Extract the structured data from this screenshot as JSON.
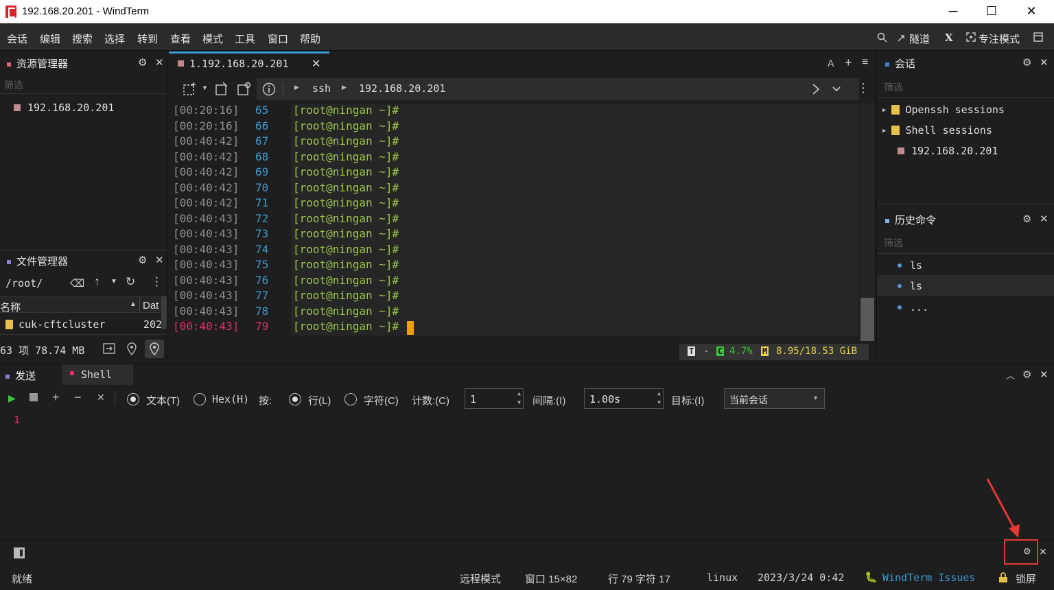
{
  "window": {
    "title": "192.168.20.201 - WindTerm",
    "minimize_glyph": "─",
    "maximize_glyph": "☐",
    "close_glyph": "✕"
  },
  "menubar": {
    "items": [
      "会话",
      "编辑",
      "搜索",
      "选择",
      "转到",
      "查看",
      "模式",
      "工具",
      "窗口",
      "帮助"
    ],
    "tunnel_label": "隧道",
    "x_label": "X",
    "focus_mode_label": "专注模式"
  },
  "explorer": {
    "title": "资源管理器",
    "filter_placeholder": "筛选",
    "host": "192.168.20.201"
  },
  "file_manager": {
    "title": "文件管理器",
    "path": "/root/",
    "col_name": "名称",
    "col_date": "Dat",
    "row_name": "cuk-cftcluster",
    "row_date": "202",
    "summary": "63 项 78.74 MB"
  },
  "terminal_tab": {
    "label": "1.192.168.20.201",
    "font_glyph": "A",
    "add_glyph": "+",
    "menu_glyph": "≡"
  },
  "breadcrumb": {
    "proto": "ssh",
    "host": "192.168.20.201"
  },
  "terminal": {
    "lines": [
      {
        "ts": "[00:20:16]",
        "n": "65",
        "prompt": "[root@ningan ~]#"
      },
      {
        "ts": "[00:20:16]",
        "n": "66",
        "prompt": "[root@ningan ~]#"
      },
      {
        "ts": "[00:40:42]",
        "n": "67",
        "prompt": "[root@ningan ~]#"
      },
      {
        "ts": "[00:40:42]",
        "n": "68",
        "prompt": "[root@ningan ~]#"
      },
      {
        "ts": "[00:40:42]",
        "n": "69",
        "prompt": "[root@ningan ~]#"
      },
      {
        "ts": "[00:40:42]",
        "n": "70",
        "prompt": "[root@ningan ~]#"
      },
      {
        "ts": "[00:40:42]",
        "n": "71",
        "prompt": "[root@ningan ~]#"
      },
      {
        "ts": "[00:40:43]",
        "n": "72",
        "prompt": "[root@ningan ~]#"
      },
      {
        "ts": "[00:40:43]",
        "n": "73",
        "prompt": "[root@ningan ~]#"
      },
      {
        "ts": "[00:40:43]",
        "n": "74",
        "prompt": "[root@ningan ~]#"
      },
      {
        "ts": "[00:40:43]",
        "n": "75",
        "prompt": "[root@ningan ~]#"
      },
      {
        "ts": "[00:40:43]",
        "n": "76",
        "prompt": "[root@ningan ~]#"
      },
      {
        "ts": "[00:40:43]",
        "n": "77",
        "prompt": "[root@ningan ~]#"
      },
      {
        "ts": "[00:40:43]",
        "n": "78",
        "prompt": "[root@ningan ~]#"
      },
      {
        "ts": "[00:40:43]",
        "n": "79",
        "prompt": "[root@ningan ~]#"
      }
    ],
    "stats": {
      "t_label": "T",
      "dash": "-",
      "c_label": "C",
      "cpu": "4.7%",
      "m_label": "M",
      "mem": "8.95/18.53 GiB"
    }
  },
  "sessions": {
    "title": "会话",
    "filter_placeholder": "筛选",
    "items": [
      "Openssh sessions",
      "Shell sessions",
      "192.168.20.201"
    ]
  },
  "history": {
    "title": "历史命令",
    "filter_placeholder": "筛选",
    "items": [
      "ls",
      "ls",
      "..."
    ]
  },
  "send_panel": {
    "tab_send": "发送",
    "tab_shell": "Shell",
    "text_label": "文本(T)",
    "hex_label": "Hex(H)",
    "by_label": "按:",
    "line_label": "行(L)",
    "char_label": "字符(C)",
    "count_label": "计数:(C)",
    "count_value": "1",
    "interval_label": "间隔:(I)",
    "interval_value": "1.00s",
    "target_label": "目标:(I)",
    "target_value": "当前会话",
    "editor_line": "1"
  },
  "statusbar": {
    "ready": "就绪",
    "remote_mode": "远程模式",
    "window_size": "窗口 15×82",
    "position": "行 79 字符 17",
    "os": "linux",
    "datetime": "2023/3/24 0:42",
    "issues": "WindTerm Issues",
    "lock": "锁屏"
  },
  "colors": {
    "accent_blue": "#3b9bd0",
    "prompt_green": "#9cc54a",
    "current_line_pink": "#e0306a",
    "cursor_orange": "#f0a000",
    "annotation_red": "#e53935"
  }
}
